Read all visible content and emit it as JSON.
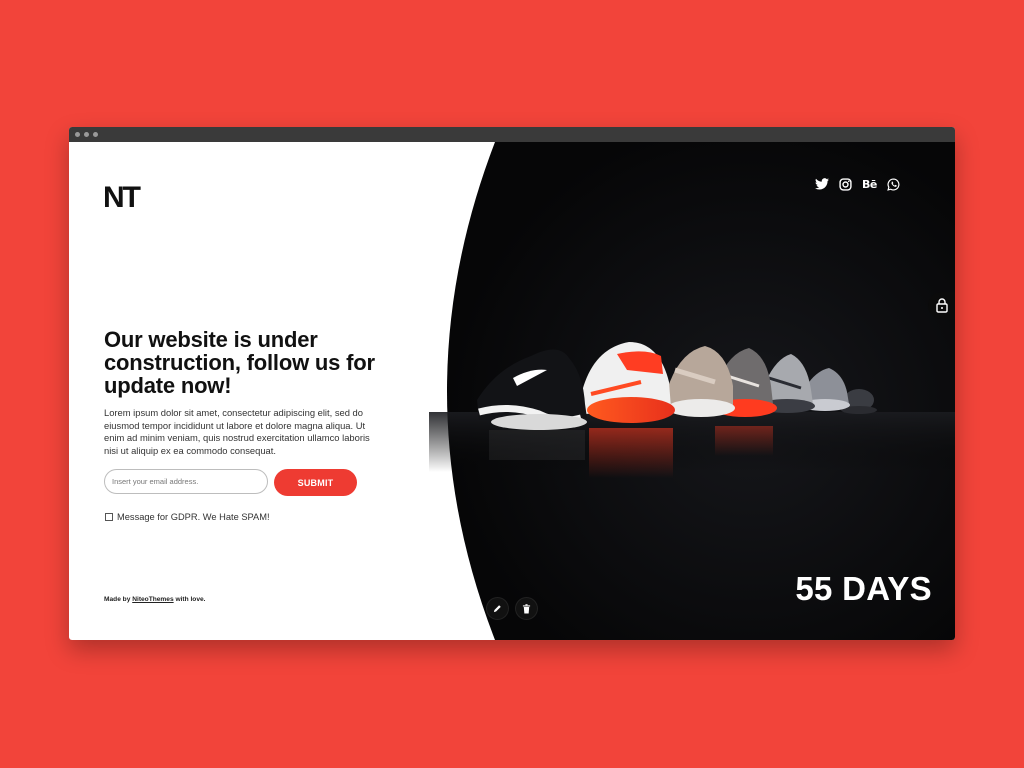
{
  "page": {
    "logo_text": "NT",
    "headline": "Our website is under construction, follow us for update now!",
    "body": "Lorem ipsum dolor sit amet, consectetur adipiscing elit, sed do eiusmod tempor incididunt ut labore et dolore magna aliqua. Ut enim ad minim veniam, quis nostrud exercitation ullamco laboris nisi ut aliquip ex ea commodo consequat.",
    "form": {
      "email_placeholder": "Insert your email address.",
      "email_value": "",
      "submit_label": "SUBMIT",
      "gdpr_label": "Message for GDPR. We Hate SPAM!",
      "gdpr_checked": false
    },
    "footer": {
      "prefix": "Made by ",
      "link_text": "NiteoThemes",
      "suffix": " with love."
    },
    "countdown": "55 DAYS",
    "social": [
      {
        "name": "twitter-icon"
      },
      {
        "name": "instagram-icon"
      },
      {
        "name": "behance-icon",
        "text": "Bē"
      },
      {
        "name": "whatsapp-icon"
      }
    ],
    "icons": [
      "lock-icon",
      "pencil-icon",
      "trash-icon"
    ]
  },
  "colors": {
    "background": "#f2443a",
    "accent": "#ee3b32",
    "dark_panel": "#0c0c0d",
    "text": "#111111"
  }
}
